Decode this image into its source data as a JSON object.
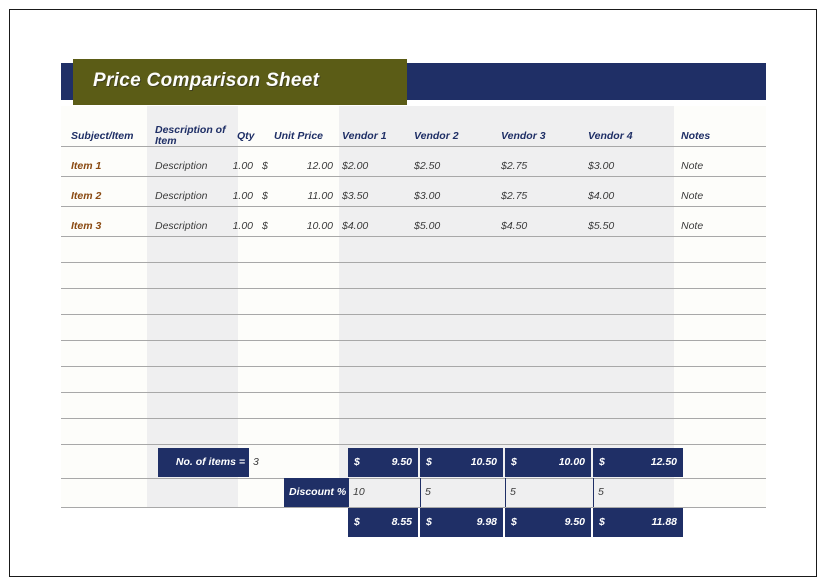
{
  "document": {
    "title": "Price Comparison Sheet"
  },
  "table": {
    "columns": [
      {
        "key": "subject",
        "label": "Subject/Item"
      },
      {
        "key": "desc",
        "label": "Description of Item"
      },
      {
        "key": "qty",
        "label": "Qty"
      },
      {
        "key": "unit",
        "label": "Unit Price"
      },
      {
        "key": "vendor1",
        "label": "Vendor 1"
      },
      {
        "key": "vendor2",
        "label": "Vendor 2"
      },
      {
        "key": "vendor3",
        "label": "Vendor 3"
      },
      {
        "key": "vendor4",
        "label": "Vendor 4"
      },
      {
        "key": "notes",
        "label": "Notes"
      }
    ],
    "rows": [
      {
        "subject": "Item 1",
        "desc": "Description",
        "qty": "1.00",
        "unit_symbol": "$",
        "unit_value": "12.00",
        "vendor1": "$2.00",
        "vendor2": "$2.50",
        "vendor3": "$2.75",
        "vendor4": "$3.00",
        "notes": "Note"
      },
      {
        "subject": "Item 2",
        "desc": "Description",
        "qty": "1.00",
        "unit_symbol": "$",
        "unit_value": "11.00",
        "vendor1": "$3.50",
        "vendor2": "$3.00",
        "vendor3": "$2.75",
        "vendor4": "$4.00",
        "notes": "Note"
      },
      {
        "subject": "Item 3",
        "desc": "Description",
        "qty": "1.00",
        "unit_symbol": "$",
        "unit_value": "10.00",
        "vendor1": "$4.00",
        "vendor2": "$5.00",
        "vendor3": "$4.50",
        "vendor4": "$5.50",
        "notes": "Note"
      }
    ],
    "empty_row_count": 12
  },
  "summary": {
    "item_count_label": "No. of items =",
    "item_count_value": "3",
    "discount_label": "Discount %",
    "subtotal_symbol": "$",
    "subtotals": [
      {
        "vendor": "Vendor 1",
        "symbol": "$",
        "value": "9.50"
      },
      {
        "vendor": "Vendor 2",
        "symbol": "$",
        "value": "10.50"
      },
      {
        "vendor": "Vendor 3",
        "symbol": "$",
        "value": "10.00"
      },
      {
        "vendor": "Vendor 4",
        "symbol": "$",
        "value": "12.50"
      }
    ],
    "discounts": [
      {
        "vendor": "Vendor 1",
        "value": "10"
      },
      {
        "vendor": "Vendor 2",
        "value": "5"
      },
      {
        "vendor": "Vendor 3",
        "value": "5"
      },
      {
        "vendor": "Vendor 4",
        "value": "5"
      }
    ],
    "totals": [
      {
        "vendor": "Vendor 1",
        "symbol": "$",
        "value": "8.55"
      },
      {
        "vendor": "Vendor 2",
        "symbol": "$",
        "value": "9.98"
      },
      {
        "vendor": "Vendor 3",
        "symbol": "$",
        "value": "9.50"
      },
      {
        "vendor": "Vendor 4",
        "symbol": "$",
        "value": "11.88"
      }
    ]
  },
  "colors": {
    "banner_navy": "#1f2f66",
    "banner_olive": "#5b5c16",
    "header_text": "#1f2f66",
    "item_text": "#8a4a12",
    "shaded_column": "#efeff0",
    "plain_column": "#fdfdfa",
    "grid_line": "#a8a8a8"
  }
}
